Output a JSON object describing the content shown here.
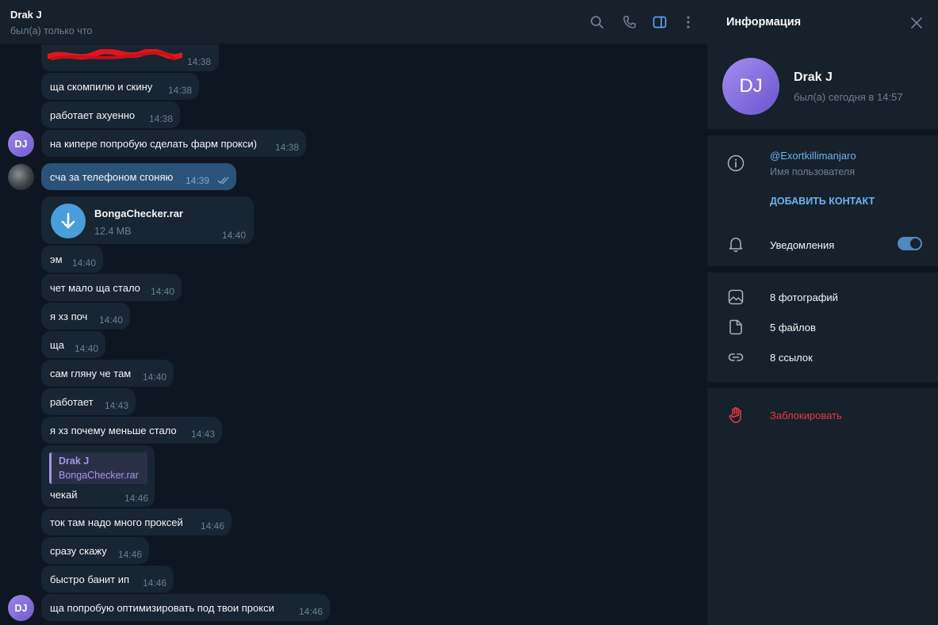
{
  "chat": {
    "title": "Drak J",
    "status": "был(а) только что",
    "avatar_initials": "DJ",
    "icons": [
      "search-icon",
      "phone-icon",
      "sidebar-toggle-icon",
      "more-vert-icon"
    ],
    "partial_top_time": "14:38",
    "messages": [
      {
        "text": "ща скомпилю и скину",
        "time": "14:38"
      },
      {
        "text": "работает ахуенно",
        "time": "14:38"
      },
      {
        "text": "на кипере попробую сделать фарм прокси)",
        "time": "14:38"
      },
      {
        "text": "сча за телефоном сгоняю",
        "time": "14:39",
        "status": "read"
      },
      {
        "text": "эм",
        "time": "14:40"
      },
      {
        "text": "чет мало ща стало",
        "time": "14:40"
      },
      {
        "text": "я хз поч",
        "time": "14:40"
      },
      {
        "text": "ща",
        "time": "14:40"
      },
      {
        "text": "сам гляну че там",
        "time": "14:40"
      },
      {
        "text": "работает",
        "time": "14:43"
      },
      {
        "text": "я хз почему меньше стало",
        "time": "14:43"
      },
      {
        "text": "чекай",
        "time": "14:46"
      },
      {
        "text": "ток там надо много проксей",
        "time": "14:46"
      },
      {
        "text": "сразу скажу",
        "time": "14:46"
      },
      {
        "text": "быстро банит ип",
        "time": "14:46"
      },
      {
        "text": "ща попробую оптимизировать под твои прокси",
        "time": "14:46"
      }
    ],
    "file": {
      "name": "BongaChecker.rar",
      "size": "12.4 MB",
      "time": "14:40"
    },
    "reply": {
      "author": "Drak J",
      "text": "BongaChecker.rar"
    }
  },
  "info": {
    "title": "Информация",
    "name": "Drak J",
    "initials": "DJ",
    "seen": "был(а) сегодня в 14:57",
    "username": "@Exortkillimanjaro",
    "username_caption": "Имя пользователя",
    "add_contact": "ДОБАВИТЬ КОНТАКТ",
    "notifications": "Уведомления",
    "notifications_on": true,
    "photos": "8 фотографий",
    "files": "5 файлов",
    "links": "8 ссылок",
    "block": "Заблокировать"
  },
  "colors": {
    "background": "#0e1621",
    "panel": "#17212b",
    "incoming_bubble": "#182533",
    "outgoing_bubble": "#2b5278",
    "accent": "#5288c1",
    "link": "#6ab3f3",
    "danger": "#ec3942",
    "reply_accent": "#a695e7"
  }
}
